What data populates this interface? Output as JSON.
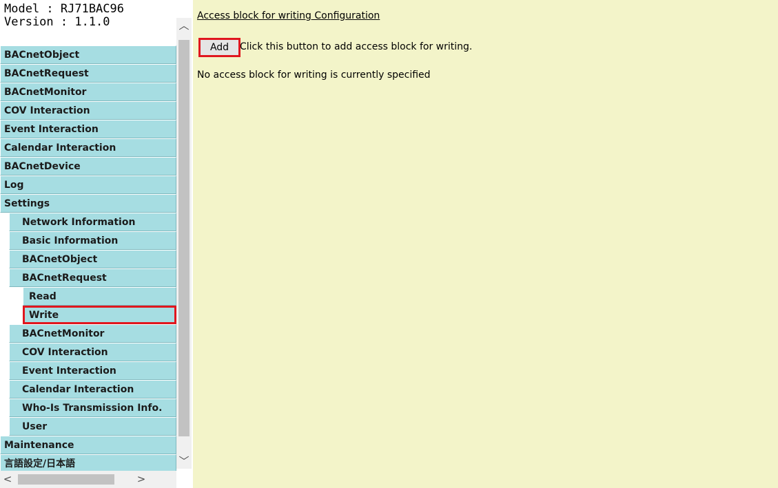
{
  "sidebar": {
    "model_label": "Model : RJ71BAC96",
    "version_label": "Version : 1.1.0",
    "items": [
      {
        "label": "BACnetObject",
        "level": 0
      },
      {
        "label": "BACnetRequest",
        "level": 0
      },
      {
        "label": "BACnetMonitor",
        "level": 0
      },
      {
        "label": "COV Interaction",
        "level": 0
      },
      {
        "label": "Event Interaction",
        "level": 0
      },
      {
        "label": "Calendar Interaction",
        "level": 0
      },
      {
        "label": "BACnetDevice",
        "level": 0
      },
      {
        "label": "Log",
        "level": 0
      },
      {
        "label": "Settings",
        "level": 0
      },
      {
        "label": "Network Information",
        "level": 1
      },
      {
        "label": "Basic Information",
        "level": 1
      },
      {
        "label": "BACnetObject",
        "level": 1
      },
      {
        "label": "BACnetRequest",
        "level": 1
      },
      {
        "label": "Read",
        "level": 2
      },
      {
        "label": "Write",
        "level": 2,
        "selected": true
      },
      {
        "label": "BACnetMonitor",
        "level": 1
      },
      {
        "label": "COV Interaction",
        "level": 1
      },
      {
        "label": "Event Interaction",
        "level": 1
      },
      {
        "label": "Calendar Interaction",
        "level": 1
      },
      {
        "label": "Who-Is Transmission Info.",
        "level": 1
      },
      {
        "label": "User",
        "level": 1
      },
      {
        "label": "Maintenance",
        "level": 0
      },
      {
        "label": "言語設定/日本語",
        "level": 0
      }
    ]
  },
  "main": {
    "config_link": "Access block for writing Configuration",
    "add_button": "Add",
    "add_hint": "Click this button to add access block for writing.",
    "status": "No access block for writing is currently specified"
  },
  "colors": {
    "nav_bg": "#a6dde2",
    "content_bg": "#f3f4c9",
    "highlight": "#e0161e"
  }
}
